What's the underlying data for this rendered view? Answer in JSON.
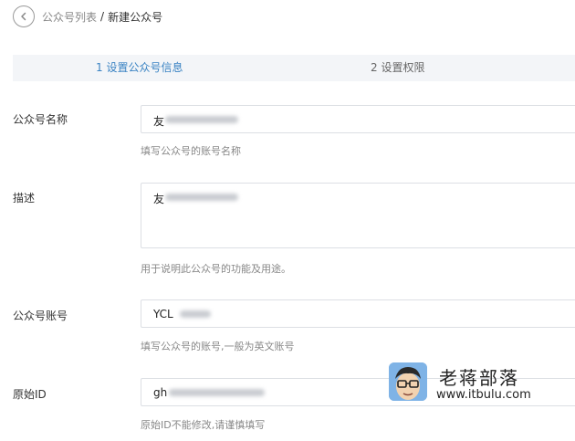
{
  "breadcrumb": {
    "parent": "公众号列表",
    "separator": "/",
    "current": "新建公众号"
  },
  "steps": [
    {
      "label": "1 设置公众号信息",
      "state": "active"
    },
    {
      "label": "2 设置权限",
      "state": "inactive"
    }
  ],
  "form": {
    "name": {
      "label": "公众号名称",
      "value": "友",
      "hint": "填写公众号的账号名称"
    },
    "description": {
      "label": "描述",
      "value": "友",
      "hint": "用于说明此公众号的功能及用途。"
    },
    "account": {
      "label": "公众号账号",
      "value": "YCL",
      "hint": "填写公众号的账号,一般为英文账号"
    },
    "original_id": {
      "label": "原始ID",
      "value": "gh",
      "hint": "原始ID不能修改,请谨慎填写"
    }
  },
  "watermark": {
    "title": "老蒋部落",
    "url": "www.itbulu.com"
  },
  "colors": {
    "accent": "#3a83c3",
    "step_bar_bg": "#f3f5f8",
    "border": "#dcdfe4"
  },
  "icons": {
    "back": "chevron-left-circle-icon"
  }
}
